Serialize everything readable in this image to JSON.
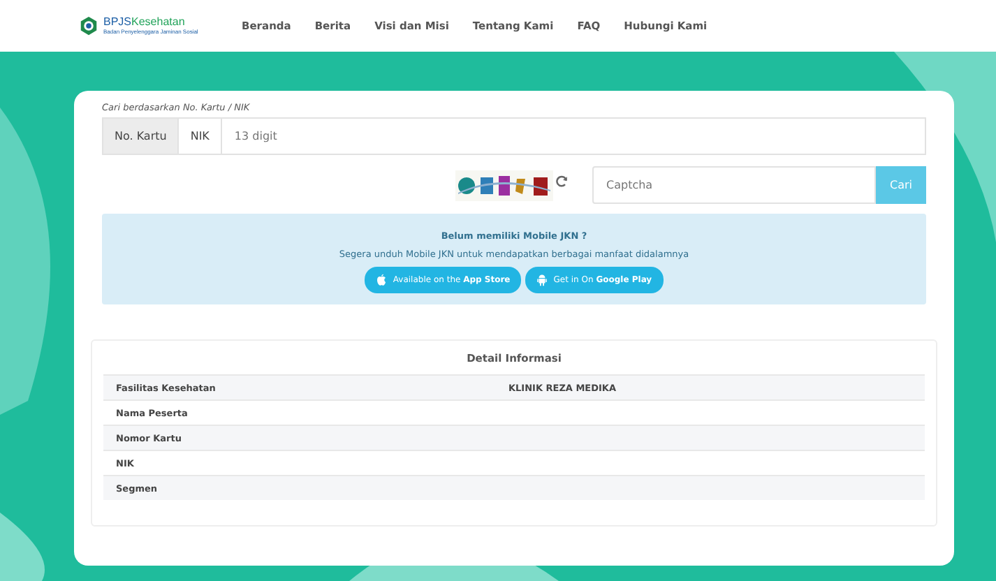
{
  "header": {
    "logo": {
      "name": "BPJS",
      "name_accent": "Kesehatan",
      "tagline": "Badan Penyelenggara Jaminan Sosial"
    },
    "nav": [
      "Beranda",
      "Berita",
      "Visi dan Misi",
      "Tentang Kami",
      "FAQ",
      "Hubungi Kami"
    ]
  },
  "search": {
    "hint": "Cari berdasarkan No. Kartu / NIK",
    "tabs": [
      {
        "label": "No. Kartu",
        "selected": true
      },
      {
        "label": "NIK",
        "selected": false
      }
    ],
    "placeholder": "13 digit",
    "captcha": {
      "placeholder": "Captcha",
      "button": "Cari"
    }
  },
  "promo": {
    "title": "Belum memiliki Mobile JKN ?",
    "text": "Segera unduh Mobile JKN untuk mendapatkan berbagai manfaat didalamnya",
    "buttons": [
      {
        "kind": "apple",
        "text": "Available on the **App Store**"
      },
      {
        "kind": "android",
        "text": "Get in On **Google Play**"
      }
    ]
  },
  "details": {
    "title": "Detail Informasi",
    "rows": [
      {
        "label": "Fasilitas Kesehatan",
        "value": "KLINIK REZA MEDIKA"
      },
      {
        "label": "Nama Peserta"
      },
      {
        "label": "Nomor Kartu"
      },
      {
        "label": "NIK"
      },
      {
        "label": "Segmen"
      }
    ]
  }
}
